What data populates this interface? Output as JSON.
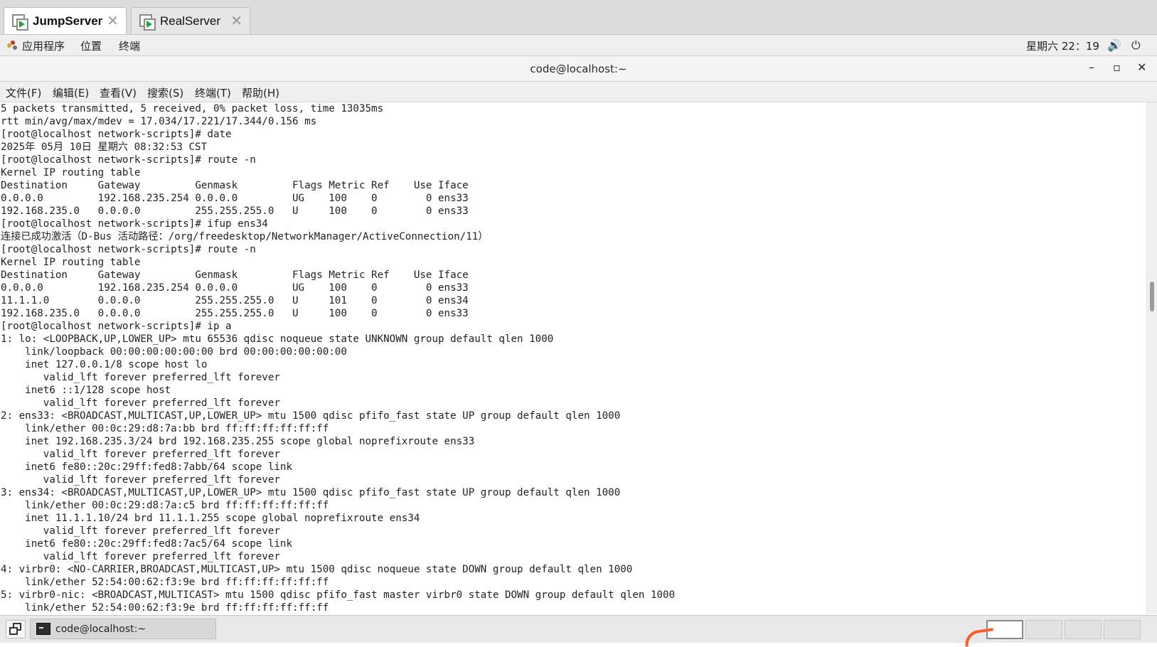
{
  "tabs": [
    {
      "label": "JumpServer",
      "active": true,
      "icon": "vm-running-icon",
      "close": "✕"
    },
    {
      "label": "RealServer",
      "active": false,
      "icon": "vm-running-icon",
      "close": "✕"
    }
  ],
  "panel": {
    "apps_icon": "gnome-foot-icon",
    "applications": "应用程序",
    "places": "位置",
    "terminal": "终端",
    "clock": "星期六 22：19",
    "volume_icon": "🔊",
    "power_icon": "⏻"
  },
  "window": {
    "title": "code@localhost:~",
    "minimize": "–",
    "maximize": "▫",
    "close": "✕"
  },
  "menu": [
    "文件(F)",
    "编辑(E)",
    "查看(V)",
    "搜索(S)",
    "终端(T)",
    "帮助(H)"
  ],
  "terminal": {
    "lines": [
      "5 packets transmitted, 5 received, 0% packet loss, time 13035ms",
      "rtt min/avg/max/mdev = 17.034/17.221/17.344/0.156 ms",
      "[root@localhost network-scripts]# date",
      "2025年 05月 10日 星期六 08:32:53 CST",
      "[root@localhost network-scripts]# route -n",
      "Kernel IP routing table",
      "Destination     Gateway         Genmask         Flags Metric Ref    Use Iface",
      "0.0.0.0         192.168.235.254 0.0.0.0         UG    100    0        0 ens33",
      "192.168.235.0   0.0.0.0         255.255.255.0   U     100    0        0 ens33",
      "[root@localhost network-scripts]# ifup ens34",
      "连接已成功激活（D-Bus 活动路径：/org/freedesktop/NetworkManager/ActiveConnection/11）",
      "[root@localhost network-scripts]# route -n",
      "Kernel IP routing table",
      "Destination     Gateway         Genmask         Flags Metric Ref    Use Iface",
      "0.0.0.0         192.168.235.254 0.0.0.0         UG    100    0        0 ens33",
      "11.1.1.0        0.0.0.0         255.255.255.0   U     101    0        0 ens34",
      "192.168.235.0   0.0.0.0         255.255.255.0   U     100    0        0 ens33",
      "[root@localhost network-scripts]# ip a",
      "1: lo: <LOOPBACK,UP,LOWER_UP> mtu 65536 qdisc noqueue state UNKNOWN group default qlen 1000",
      "    link/loopback 00:00:00:00:00:00 brd 00:00:00:00:00:00",
      "    inet 127.0.0.1/8 scope host lo",
      "       valid_lft forever preferred_lft forever",
      "    inet6 ::1/128 scope host",
      "       valid_lft forever preferred_lft forever",
      "2: ens33: <BROADCAST,MULTICAST,UP,LOWER_UP> mtu 1500 qdisc pfifo_fast state UP group default qlen 1000",
      "    link/ether 00:0c:29:d8:7a:bb brd ff:ff:ff:ff:ff:ff",
      "    inet 192.168.235.3/24 brd 192.168.235.255 scope global noprefixroute ens33",
      "       valid_lft forever preferred_lft forever",
      "    inet6 fe80::20c:29ff:fed8:7abb/64 scope link",
      "       valid_lft forever preferred_lft forever",
      "3: ens34: <BROADCAST,MULTICAST,UP,LOWER_UP> mtu 1500 qdisc pfifo_fast state UP group default qlen 1000",
      "    link/ether 00:0c:29:d8:7a:c5 brd ff:ff:ff:ff:ff:ff",
      "    inet 11.1.1.10/24 brd 11.1.1.255 scope global noprefixroute ens34",
      "       valid_lft forever preferred_lft forever",
      "    inet6 fe80::20c:29ff:fed8:7ac5/64 scope link",
      "       valid_lft forever preferred_lft forever",
      "4: virbr0: <NO-CARRIER,BROADCAST,MULTICAST,UP> mtu 1500 qdisc noqueue state DOWN group default qlen 1000",
      "    link/ether 52:54:00:62:f3:9e brd ff:ff:ff:ff:ff:ff",
      "5: virbr0-nic: <BROADCAST,MULTICAST> mtu 1500 qdisc pfifo_fast master virbr0 state DOWN group default qlen 1000",
      "    link/ether 52:54:00:62:f3:9e brd ff:ff:ff:ff:ff:ff"
    ]
  },
  "taskbar": {
    "show_desktop_icon": "show-desktop-icon",
    "window_button": {
      "label": "code@localhost:~",
      "icon": "terminal-icon"
    },
    "workspace_count": 4,
    "active_workspace": 1
  },
  "colors": {
    "play_green": "#1da63a",
    "notification_orange": "#ff5a1f"
  }
}
